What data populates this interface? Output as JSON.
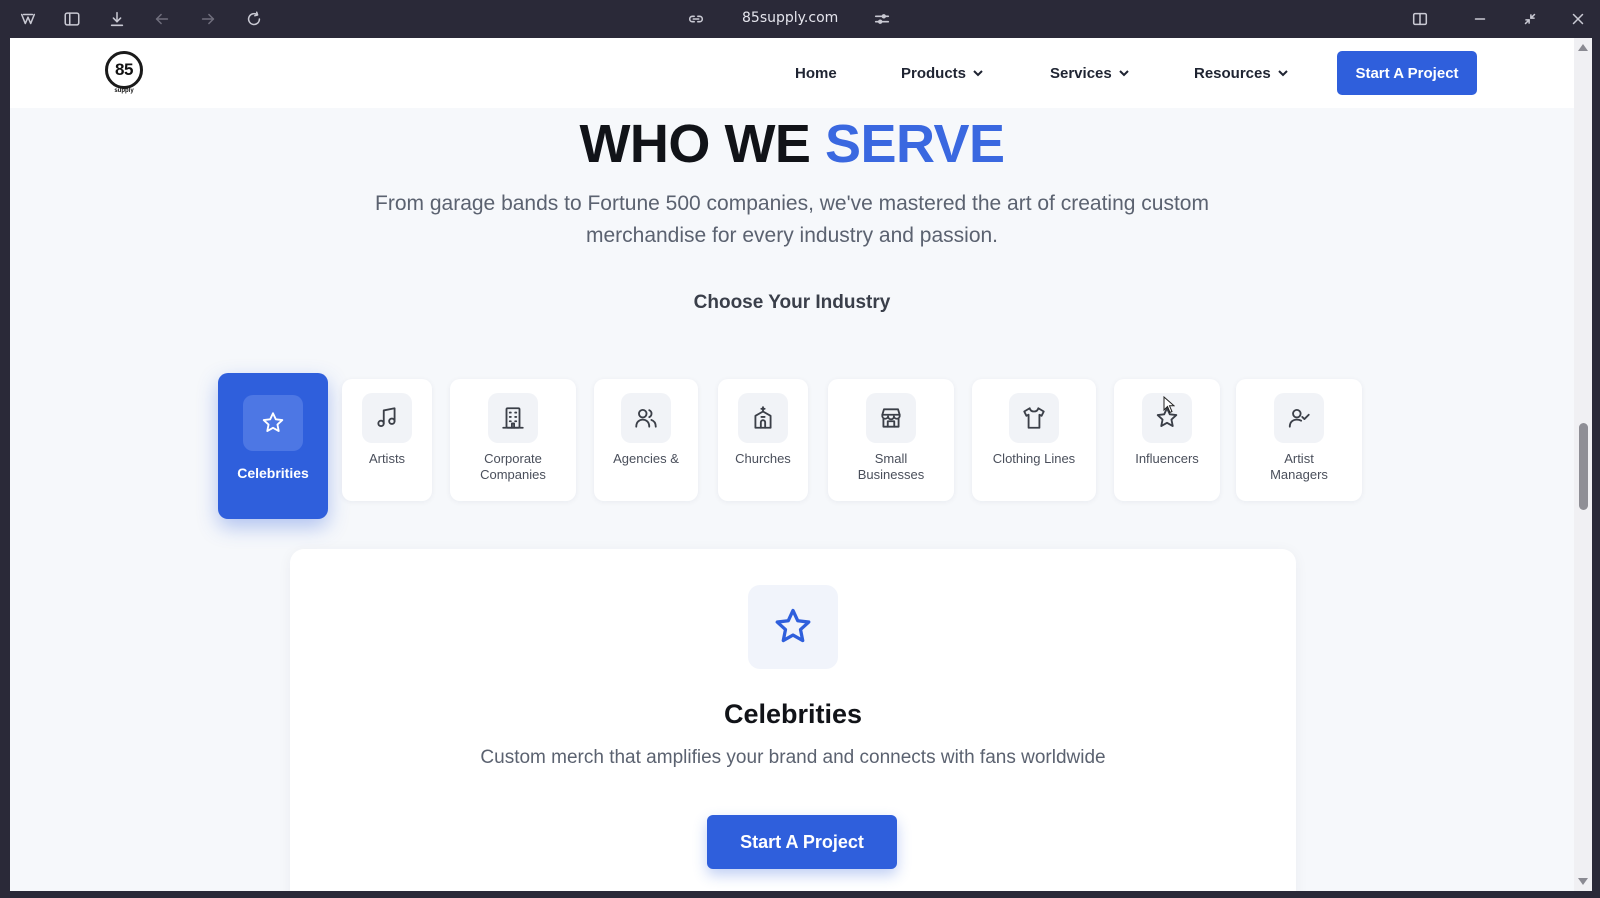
{
  "browser": {
    "url": "85supply.com"
  },
  "header": {
    "logo_text": "85",
    "logo_sub": "supply",
    "nav": {
      "home": "Home",
      "products": "Products",
      "services": "Services",
      "resources": "Resources"
    },
    "cta": "Start A Project"
  },
  "hero": {
    "title_part1": "WHO WE ",
    "title_part2": "SERVE",
    "subtitle": "From garage bands to Fortune 500 companies, we've mastered the art of creating custom merchandise for every industry and passion.",
    "choose": "Choose Your Industry"
  },
  "industries": [
    {
      "label": "Celebrities",
      "icon": "star-icon",
      "selected": true
    },
    {
      "label": "Artists",
      "icon": "music-note-icon",
      "selected": false
    },
    {
      "label": "Corporate Companies",
      "icon": "building-icon",
      "selected": false
    },
    {
      "label": "Agencies &",
      "icon": "users-icon",
      "selected": false
    },
    {
      "label": "Churches",
      "icon": "church-icon",
      "selected": false
    },
    {
      "label": "Small Businesses",
      "icon": "store-icon",
      "selected": false
    },
    {
      "label": "Clothing Lines",
      "icon": "shirt-icon",
      "selected": false
    },
    {
      "label": "Influencers",
      "icon": "star-icon",
      "selected": false
    },
    {
      "label": "Artist Managers",
      "icon": "user-check-icon",
      "selected": false
    }
  ],
  "detail": {
    "icon": "star-icon",
    "title": "Celebrities",
    "description": "Custom merch that amplifies your brand and connects with fans worldwide",
    "cta": "Start A Project"
  },
  "colors": {
    "accent": "#2f5fdc",
    "heading_accent": "#3a68e0",
    "chrome": "#2a2938"
  }
}
